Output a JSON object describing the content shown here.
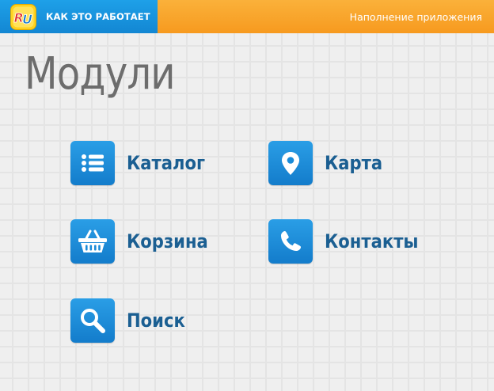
{
  "header": {
    "logo_icon": "ru-logo-icon",
    "logo_text": "RU",
    "how_it_works": "КАК ЭТО РАБОТАЕТ",
    "app_fill": "Наполнение приложения",
    "left_color": "#1a93df",
    "right_color": "#f8a52c"
  },
  "page": {
    "title": "Модули"
  },
  "modules": [
    {
      "label": "Каталог",
      "icon": "list-icon"
    },
    {
      "label": "Карта",
      "icon": "map-pin-icon"
    },
    {
      "label": "Корзина",
      "icon": "basket-icon"
    },
    {
      "label": "Контакты",
      "icon": "phone-icon"
    },
    {
      "label": "Поиск",
      "icon": "search-icon"
    }
  ],
  "colors": {
    "icon_bg": "#1a8bd8",
    "label": "#1b5f92",
    "title": "#6d6d6d",
    "background": "#efefef"
  }
}
